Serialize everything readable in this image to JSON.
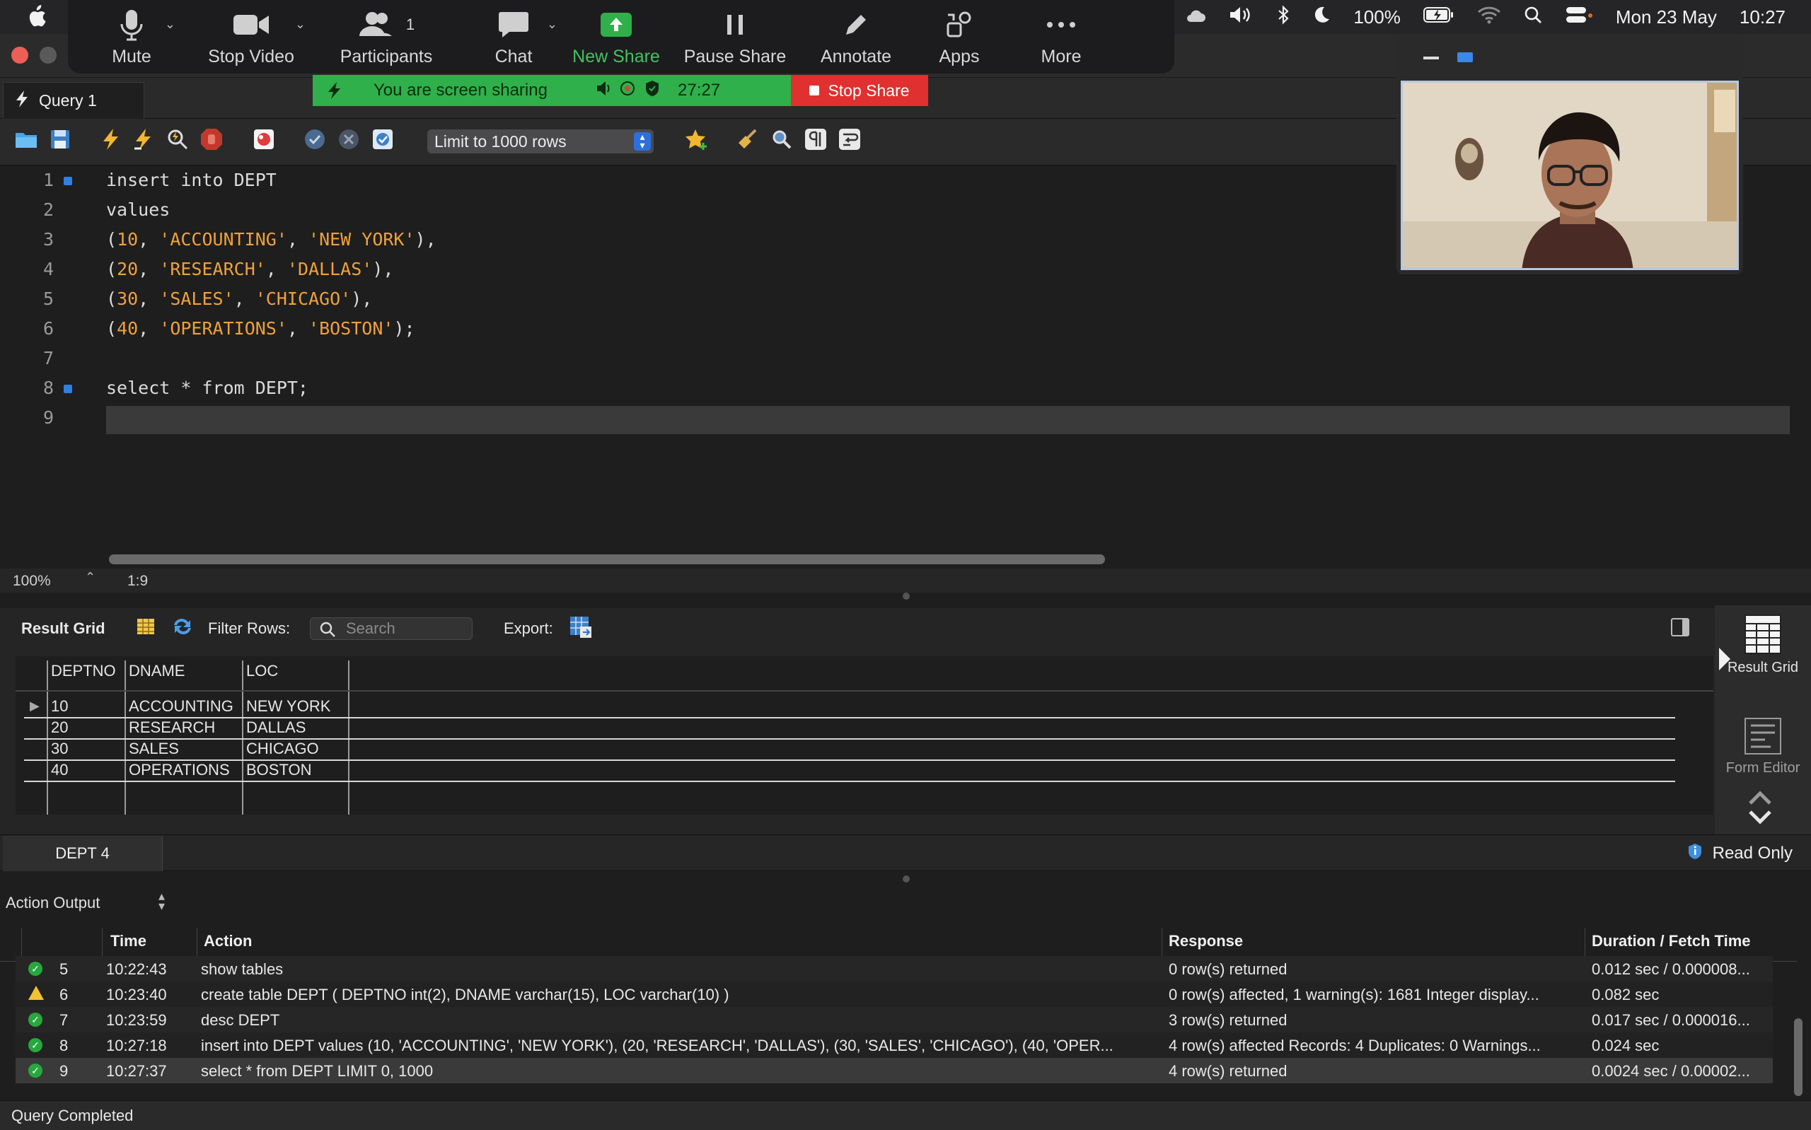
{
  "menubar": {
    "battery": "100%",
    "date": "Mon 23 May",
    "time": "10:27"
  },
  "zoom": {
    "buttons": [
      {
        "label": "Mute",
        "icon": "microphone-icon"
      },
      {
        "label": "Stop Video",
        "icon": "video-camera-icon"
      },
      {
        "label": "Participants",
        "icon": "participants-icon",
        "count": "1"
      },
      {
        "label": "Chat",
        "icon": "chat-icon"
      },
      {
        "label": "New Share",
        "icon": "share-up-arrow-icon"
      },
      {
        "label": "Pause Share",
        "icon": "pause-icon"
      },
      {
        "label": "Annotate",
        "icon": "pencil-icon"
      },
      {
        "label": "Apps",
        "icon": "apps-icon"
      },
      {
        "label": "More",
        "icon": "more-dots-icon"
      }
    ],
    "share_banner": {
      "message": "You are screen sharing",
      "timer": "27:27",
      "stop_label": "Stop Share"
    }
  },
  "query_tab": {
    "label": "Query 1"
  },
  "sql_toolbar": {
    "limit_select": "Limit to 1000 rows"
  },
  "editor": {
    "lines": [
      {
        "n": "1",
        "text": "insert into DEPT"
      },
      {
        "n": "2",
        "text": "values"
      },
      {
        "n": "3",
        "text": "(10, 'ACCOUNTING', 'NEW YORK'),"
      },
      {
        "n": "4",
        "text": "(20, 'RESEARCH', 'DALLAS'),"
      },
      {
        "n": "5",
        "text": "(30, 'SALES', 'CHICAGO'),"
      },
      {
        "n": "6",
        "text": "(40, 'OPERATIONS', 'BOSTON');"
      },
      {
        "n": "7",
        "text": ""
      },
      {
        "n": "8",
        "text": "select * from DEPT;"
      },
      {
        "n": "9",
        "text": ""
      }
    ],
    "zoom": "100%",
    "cursor_pos": "1:9"
  },
  "result": {
    "title": "Result Grid",
    "filter_label": "Filter Rows:",
    "search_placeholder": "Search",
    "export_label": "Export:",
    "columns": [
      "DEPTNO",
      "DNAME",
      "LOC"
    ],
    "rows": [
      [
        "10",
        "ACCOUNTING",
        "NEW YORK"
      ],
      [
        "20",
        "RESEARCH",
        "DALLAS"
      ],
      [
        "30",
        "SALES",
        "CHICAGO"
      ],
      [
        "40",
        "OPERATIONS",
        "BOSTON"
      ]
    ],
    "side_result_grid": "Result Grid",
    "side_form_editor": "Form Editor"
  },
  "result_tabs": {
    "tab": "DEPT 4",
    "read_only": "Read Only"
  },
  "action_output": {
    "title": "Action Output",
    "columns": [
      "Time",
      "Action",
      "Response",
      "Duration / Fetch Time"
    ],
    "rows": [
      {
        "status": "ok",
        "n": "5",
        "time": "10:22:43",
        "action": "show tables",
        "response": "0 row(s) returned",
        "duration": "0.012 sec / 0.000008..."
      },
      {
        "status": "warn",
        "n": "6",
        "time": "10:23:40",
        "action": "create table DEPT ( DEPTNO int(2), DNAME varchar(15), LOC varchar(10) )",
        "response": "0 row(s) affected, 1 warning(s): 1681 Integer display...",
        "duration": "0.082 sec"
      },
      {
        "status": "ok",
        "n": "7",
        "time": "10:23:59",
        "action": "desc DEPT",
        "response": "3 row(s) returned",
        "duration": "0.017 sec / 0.000016..."
      },
      {
        "status": "ok",
        "n": "8",
        "time": "10:27:18",
        "action": "insert into DEPT  values (10, 'ACCOUNTING', 'NEW YORK'), (20, 'RESEARCH', 'DALLAS'), (30, 'SALES', 'CHICAGO'), (40, 'OPER...",
        "response": "4 row(s) affected Records: 4  Duplicates: 0  Warnings...",
        "duration": "0.024 sec"
      },
      {
        "status": "ok",
        "n": "9",
        "time": "10:27:37",
        "action": "select * from DEPT LIMIT 0, 1000",
        "response": "4 row(s) returned",
        "duration": "0.0024 sec / 0.00002..."
      }
    ]
  },
  "status": "Query Completed"
}
